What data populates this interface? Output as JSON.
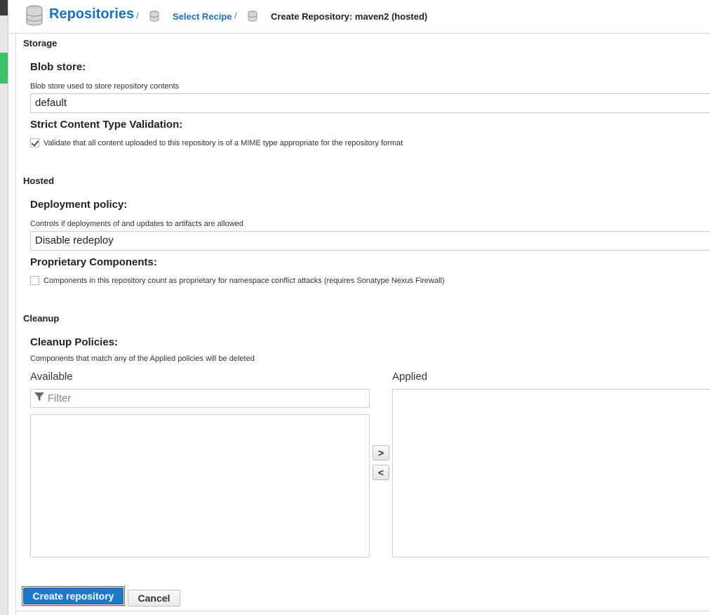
{
  "header": {
    "title": "Repositories",
    "separator": "/",
    "crumb_link": "Select Recipe",
    "crumb_current": "Create Repository: maven2 (hosted)"
  },
  "storage": {
    "section_title": "Storage",
    "blob_label": "Blob store:",
    "blob_help": "Blob store used to store repository contents",
    "blob_value": "default",
    "strict_label": "Strict Content Type Validation:",
    "strict_text": "Validate that all content uploaded to this repository is of a MIME type appropriate for the repository format",
    "strict_checked": true
  },
  "hosted": {
    "section_title": "Hosted",
    "deploy_label": "Deployment policy:",
    "deploy_help": "Controls if deployments of and updates to artifacts are allowed",
    "deploy_value": "Disable redeploy",
    "proprietary_label": "Proprietary Components:",
    "proprietary_text": "Components in this repository count as proprietary for namespace conflict attacks (requires Sonatype Nexus Firewall)",
    "proprietary_checked": false
  },
  "cleanup": {
    "section_title": "Cleanup",
    "policies_label": "Cleanup Policies:",
    "policies_help": "Components that match any of the Applied policies will be deleted",
    "available_label": "Available",
    "applied_label": "Applied",
    "filter_placeholder": "Filter",
    "add_arrow": ">",
    "remove_arrow": "<"
  },
  "footer": {
    "create_label": "Create repository",
    "cancel_label": "Cancel"
  },
  "icons": {
    "database": "database-icon",
    "filter": "filter-icon",
    "check": "checkmark-icon"
  },
  "colors": {
    "link_blue": "#1d6fbf",
    "primary_button": "#1e7ac8",
    "highlight_red": "#e0303a",
    "nav_green": "#3cbf6a"
  }
}
